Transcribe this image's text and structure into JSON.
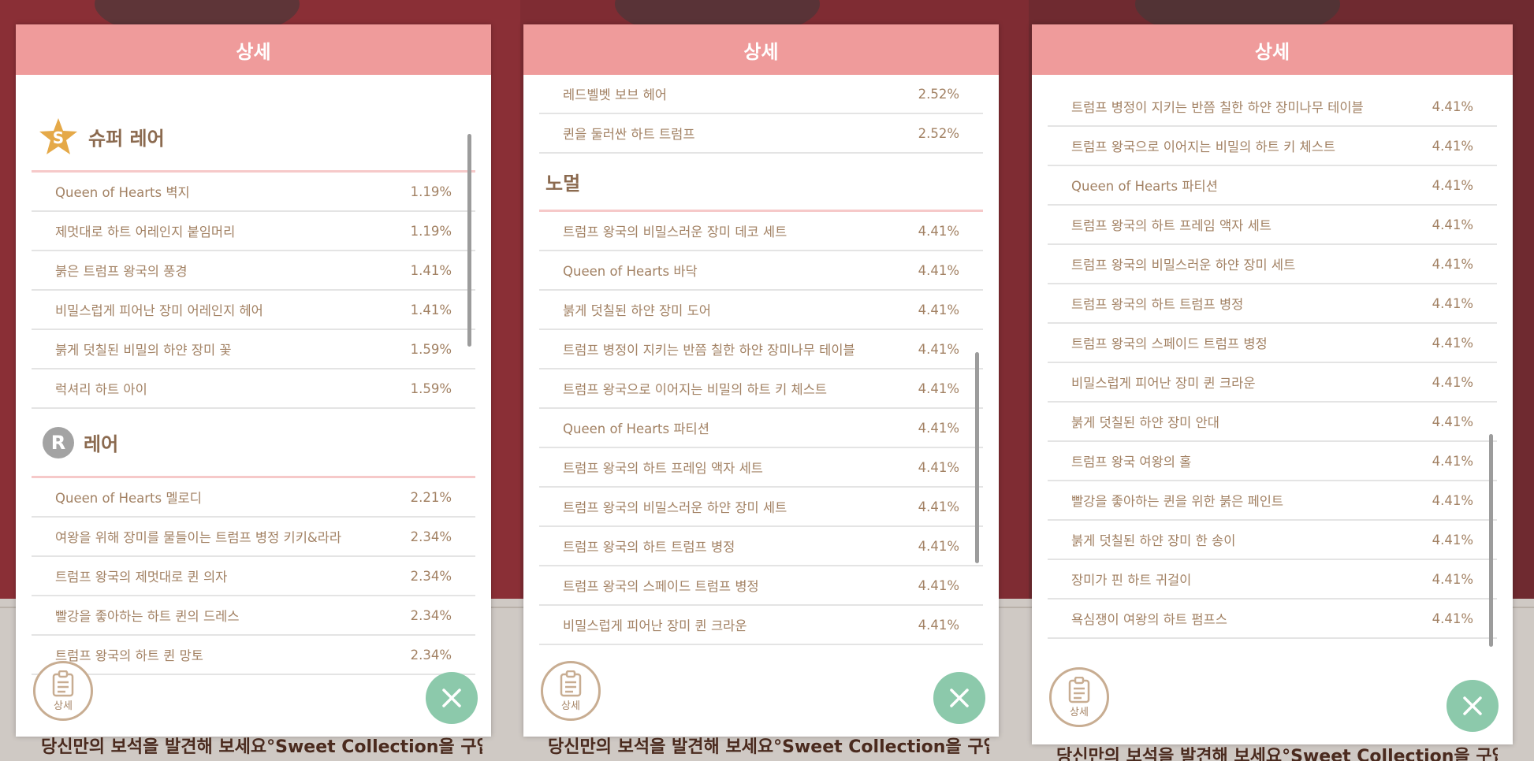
{
  "bottom_banner": "당신만의 보석을 발견해 보세요°Sweet Collection을 구입",
  "panels": [
    {
      "header": "상세",
      "super_rare_title": "슈퍼 레어",
      "super_rare_badge": "S",
      "super_rare_items": [
        {
          "name": "Queen of Hearts 벽지",
          "pct": "1.19%"
        },
        {
          "name": "제멋대로 하트 어레인지 붙임머리",
          "pct": "1.19%"
        },
        {
          "name": "붉은 트럼프 왕국의 풍경",
          "pct": "1.41%"
        },
        {
          "name": "비밀스럽게 피어난 장미 어레인지 헤어",
          "pct": "1.41%"
        },
        {
          "name": "붉게 덧칠된 비밀의 하얀 장미 꽃",
          "pct": "1.59%"
        },
        {
          "name": "럭셔리 하트 아이",
          "pct": "1.59%"
        }
      ],
      "rare_title": "레어",
      "rare_badge": "R",
      "rare_items": [
        {
          "name": "Queen of Hearts 멜로디",
          "pct": "2.21%"
        },
        {
          "name": "여왕을 위해 장미를 물들이는 트럼프 병정 키키&라라",
          "pct": "2.34%"
        },
        {
          "name": "트럼프 왕국의 제멋대로 퀸 의자",
          "pct": "2.34%"
        },
        {
          "name": "빨강을 좋아하는 하트 퀸의 드레스",
          "pct": "2.34%"
        },
        {
          "name": "트럼프 왕국의 하트 퀸 망토",
          "pct": "2.34%"
        }
      ],
      "detail_label": "상세"
    },
    {
      "header": "상세",
      "top_items": [
        {
          "name": "레드벨벳 보브 헤어",
          "pct": "2.52%"
        },
        {
          "name": "퀸을 둘러싼 하트 트럼프",
          "pct": "2.52%"
        }
      ],
      "normal_title": "노멀",
      "normal_items": [
        {
          "name": "트럼프 왕국의 비밀스러운 장미 데코 세트",
          "pct": "4.41%"
        },
        {
          "name": "Queen of Hearts 바닥",
          "pct": "4.41%"
        },
        {
          "name": "붉게 덧칠된 하얀 장미 도어",
          "pct": "4.41%"
        },
        {
          "name": "트럼프 병정이 지키는 반쯤 칠한 하얀 장미나무 테이블",
          "pct": "4.41%"
        },
        {
          "name": "트럼프 왕국으로 이어지는 비밀의 하트 키 체스트",
          "pct": "4.41%"
        },
        {
          "name": "Queen of Hearts 파티션",
          "pct": "4.41%"
        },
        {
          "name": "트럼프 왕국의 하트 프레임 액자 세트",
          "pct": "4.41%"
        },
        {
          "name": "트럼프 왕국의 비밀스러운 하얀 장미 세트",
          "pct": "4.41%"
        },
        {
          "name": "트럼프 왕국의 하트 트럼프 병정",
          "pct": "4.41%"
        },
        {
          "name": "트럼프 왕국의 스페이드 트럼프 병정",
          "pct": "4.41%"
        },
        {
          "name": "비밀스럽게 피어난 장미 퀸 크라운",
          "pct": "4.41%"
        }
      ],
      "detail_label": "상세"
    },
    {
      "header": "상세",
      "items": [
        {
          "name": "트럼프 병정이 지키는 반쯤 칠한 하얀 장미나무 테이블",
          "pct": "4.41%"
        },
        {
          "name": "트럼프 왕국으로 이어지는 비밀의 하트 키 체스트",
          "pct": "4.41%"
        },
        {
          "name": "Queen of Hearts 파티션",
          "pct": "4.41%"
        },
        {
          "name": "트럼프 왕국의 하트 프레임 액자 세트",
          "pct": "4.41%"
        },
        {
          "name": "트럼프 왕국의 비밀스러운 하얀 장미 세트",
          "pct": "4.41%"
        },
        {
          "name": "트럼프 왕국의 하트 트럼프 병정",
          "pct": "4.41%"
        },
        {
          "name": "트럼프 왕국의 스페이드 트럼프 병정",
          "pct": "4.41%"
        },
        {
          "name": "비밀스럽게 피어난 장미 퀸 크라운",
          "pct": "4.41%"
        },
        {
          "name": "붉게 덧칠된 하얀 장미 안대",
          "pct": "4.41%"
        },
        {
          "name": "트럼프 왕국 여왕의 홀",
          "pct": "4.41%"
        },
        {
          "name": "빨강을 좋아하는 퀸을 위한 붉은 페인트",
          "pct": "4.41%"
        },
        {
          "name": "붉게 덧칠된 하얀 장미 한 송이",
          "pct": "4.41%"
        },
        {
          "name": "장미가 핀 하트 귀걸이",
          "pct": "4.41%"
        },
        {
          "name": "욕심쟁이 여왕의 하트 펌프스",
          "pct": "4.41%"
        }
      ],
      "detail_label": "상세"
    }
  ],
  "colors": {
    "header": "#ef9b9b",
    "text": "#a28163",
    "close_button": "#8cc9ab",
    "section_underline": "#f6c9c9"
  },
  "icons": {
    "super_rare": "star-badge-icon",
    "rare": "circle-badge-icon",
    "detail": "clipboard-icon",
    "close": "close-icon"
  }
}
